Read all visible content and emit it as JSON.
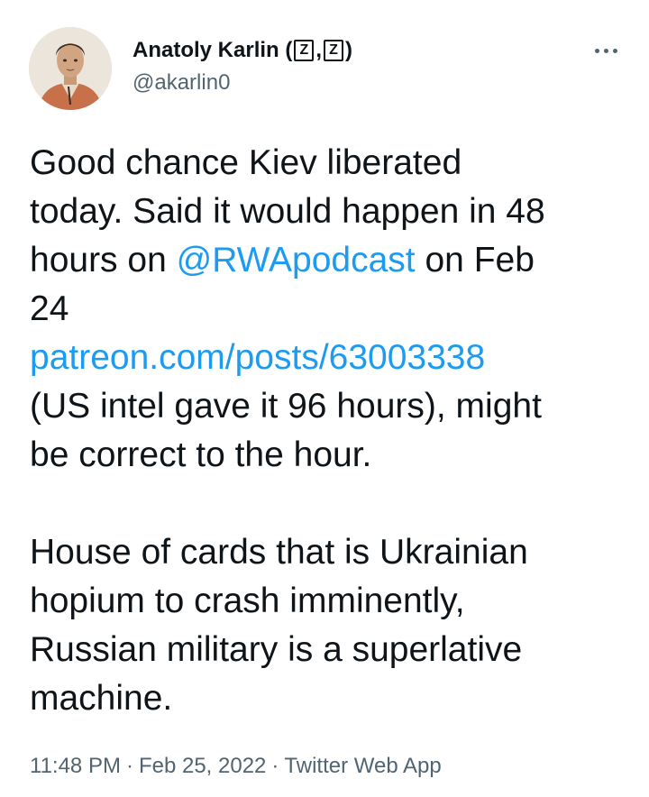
{
  "author": {
    "display_name": "Anatoly Karlin (",
    "flag_1": "Z",
    "separator": ",",
    "flag_2": "Z",
    "closing": ")",
    "handle": "@akarlin0"
  },
  "tweet": {
    "line_1": "Good chance Kiev liberated",
    "line_2": "today. Said it would happen in 48",
    "line_3_pre": "hours on ",
    "mention": "@RWApodcast",
    "line_3_post": " on Feb",
    "line_4": "24",
    "link": "patreon.com/posts/63003338",
    "line_6": "(US intel gave it 96 hours), might",
    "line_7": "be correct to the hour.",
    "p2_line_1": "House of cards that is Ukrainian",
    "p2_line_2": "hopium to crash imminently,",
    "p2_line_3": "Russian military is a superlative",
    "p2_line_4": "machine."
  },
  "meta": {
    "time": "11:48 PM",
    "date": "Feb 25, 2022",
    "client": "Twitter Web App",
    "dot": "·"
  },
  "colors": {
    "link": "#1d9bf0",
    "text": "#0f1419",
    "secondary": "#536471"
  },
  "icons": {
    "more": "more-horizontal-icon"
  }
}
